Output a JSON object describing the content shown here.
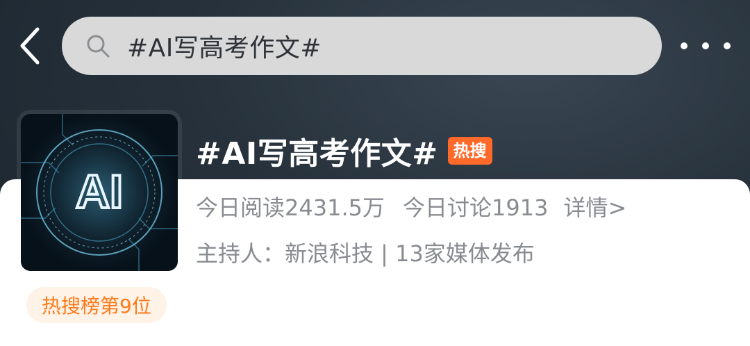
{
  "header": {
    "search_query": "#AI写高考作文#",
    "back_icon": "chevron-left-icon",
    "more_icon": "more-horizontal-icon",
    "search_icon": "search-icon"
  },
  "topic": {
    "title": "#AI写高考作文#",
    "hot_badge": "热搜",
    "image_text": "AI",
    "stats": {
      "read": "今日阅读2431.5万",
      "discuss": "今日讨论1913",
      "detail": "详情>"
    },
    "host": "主持人：新浪科技 | 13家媒体发布",
    "rank": "热搜榜第9位"
  },
  "colors": {
    "accent": "#ff6a2b",
    "rank_text": "#ff7a1a",
    "rank_bg": "#fff2e6",
    "muted_text": "#888b90"
  }
}
